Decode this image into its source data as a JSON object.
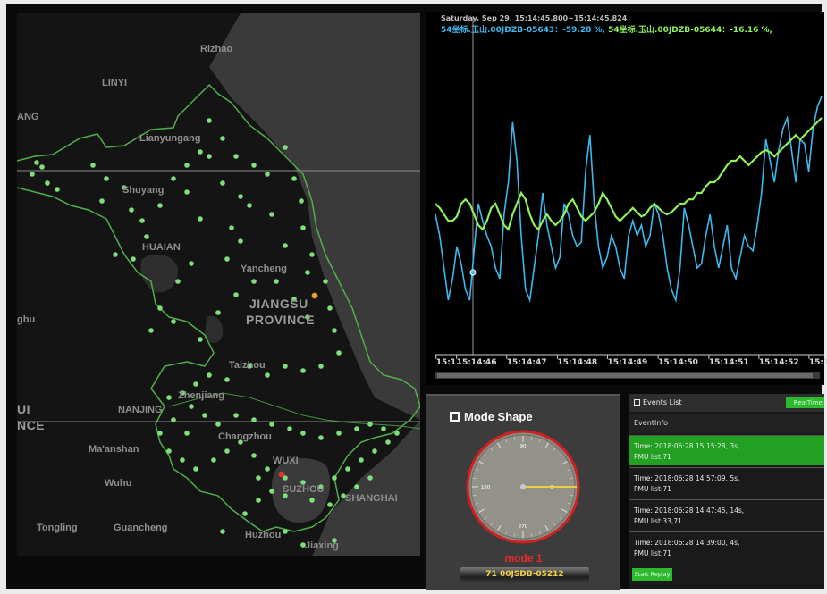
{
  "map": {
    "cities": [
      {
        "id": "rizhao",
        "label": "Rizhao",
        "big": false
      },
      {
        "id": "linyi",
        "label": "LINYI",
        "big": false
      },
      {
        "id": "lianyungang",
        "label": "Lianyungang",
        "big": false
      },
      {
        "id": "shuyang",
        "label": "Shuyang",
        "big": false
      },
      {
        "id": "huaian",
        "label": "HUAIAN",
        "big": false
      },
      {
        "id": "yancheng",
        "label": "Yancheng",
        "big": false
      },
      {
        "id": "jiangsu",
        "label": "JIANGSU",
        "big": true
      },
      {
        "id": "province",
        "label": "PROVINCE",
        "big": true
      },
      {
        "id": "taizhou",
        "label": "Taizhou",
        "big": false
      },
      {
        "id": "zhenjiang",
        "label": "Zhenjiang",
        "big": false
      },
      {
        "id": "nanjing",
        "label": "NANJING",
        "big": false
      },
      {
        "id": "changzhou",
        "label": "Changzhou",
        "big": false
      },
      {
        "id": "maanshan",
        "label": "Ma'anshan",
        "big": false
      },
      {
        "id": "wuxi",
        "label": "WUXI",
        "big": false
      },
      {
        "id": "wuhu",
        "label": "Wuhu",
        "big": false
      },
      {
        "id": "suzhou",
        "label": "SUZHOU",
        "big": false
      },
      {
        "id": "shanghai",
        "label": "SHANGHAI",
        "big": false
      },
      {
        "id": "tongling",
        "label": "Tongling",
        "big": false
      },
      {
        "id": "guancheng",
        "label": "Guancheng",
        "big": false
      },
      {
        "id": "huzhou",
        "label": "Huzhou",
        "big": false
      },
      {
        "id": "jiaxing",
        "label": "Jiaxing",
        "big": false
      },
      {
        "id": "ang",
        "label": "ANG",
        "big": false
      },
      {
        "id": "gbu",
        "label": "gbu",
        "big": false
      },
      {
        "id": "ui",
        "label": "UI",
        "big": false
      },
      {
        "id": "nce",
        "label": "NCE",
        "big": false
      }
    ],
    "colors": {
      "pmu_dot": "#7ee07a",
      "selected_dot": "#e83030",
      "highlight_dot": "#f0a030",
      "boundary": "#4fb04a",
      "land": "#141414",
      "sea": "#3a3a3a"
    }
  },
  "chart": {
    "header_line1": "Saturday, Sep 29, 15:14:45.800~15:14:45.824",
    "legend_a": "54坐标.玉山.00JDZB-05643：-59.28 %,",
    "legend_b": "54坐标.玉山.00JDZB-05644：-16.16 %,",
    "x_ticks": [
      "15:1...",
      "15:14:46",
      "15:14:47",
      "15:14:48",
      "15:14:49",
      "15:14:50",
      "15:14:51",
      "15:14:52",
      "15:1"
    ],
    "colors": {
      "series_a": "#3db8ef",
      "series_b": "#8ff05c"
    }
  },
  "chart_data": {
    "type": "line",
    "x_ticks": [
      "15:1...",
      "15:14:46",
      "15:14:47",
      "15:14:48",
      "15:14:49",
      "15:14:50",
      "15:14:51",
      "15:14:52",
      "15:1"
    ],
    "series": [
      {
        "name": "54坐标.玉山.00JDZB-05643",
        "color": "#3db8ef",
        "values": [
          0.45,
          0.35,
          0.2,
          0.05,
          0.15,
          0.3,
          0.22,
          0.1,
          0.05,
          0.28,
          0.5,
          0.42,
          0.35,
          0.3,
          0.2,
          0.15,
          0.45,
          0.6,
          0.88,
          0.7,
          0.35,
          0.1,
          0.05,
          0.2,
          0.35,
          0.55,
          0.4,
          0.3,
          0.2,
          0.25,
          0.5,
          0.45,
          0.35,
          0.3,
          0.32,
          0.65,
          0.82,
          0.5,
          0.3,
          0.2,
          0.25,
          0.35,
          0.3,
          0.2,
          0.15,
          0.35,
          0.42,
          0.35,
          0.4,
          0.3,
          0.35,
          0.5,
          0.45,
          0.35,
          0.2,
          0.1,
          0.05,
          0.2,
          0.48,
          0.4,
          0.3,
          0.2,
          0.22,
          0.35,
          0.45,
          0.3,
          0.2,
          0.3,
          0.4,
          0.2,
          0.15,
          0.25,
          0.35,
          0.3,
          0.28,
          0.4,
          0.55,
          0.8,
          0.7,
          0.6,
          0.75,
          0.85,
          0.9,
          0.75,
          0.6,
          0.8,
          0.78,
          0.65,
          0.85,
          0.95,
          1.0
        ]
      },
      {
        "name": "54坐标.玉山.00JDZB-05644",
        "color": "#8ff05c",
        "values": [
          0.5,
          0.48,
          0.45,
          0.42,
          0.42,
          0.44,
          0.5,
          0.52,
          0.5,
          0.45,
          0.4,
          0.38,
          0.42,
          0.48,
          0.5,
          0.45,
          0.4,
          0.38,
          0.45,
          0.5,
          0.55,
          0.52,
          0.45,
          0.4,
          0.38,
          0.42,
          0.45,
          0.42,
          0.4,
          0.42,
          0.45,
          0.5,
          0.52,
          0.48,
          0.44,
          0.42,
          0.44,
          0.46,
          0.5,
          0.55,
          0.52,
          0.48,
          0.44,
          0.42,
          0.44,
          0.46,
          0.48,
          0.46,
          0.44,
          0.45,
          0.48,
          0.5,
          0.48,
          0.46,
          0.45,
          0.46,
          0.48,
          0.5,
          0.5,
          0.52,
          0.52,
          0.55,
          0.55,
          0.58,
          0.6,
          0.6,
          0.62,
          0.65,
          0.68,
          0.7,
          0.7,
          0.72,
          0.7,
          0.68,
          0.7,
          0.72,
          0.74,
          0.75,
          0.74,
          0.72,
          0.74,
          0.76,
          0.78,
          0.8,
          0.82,
          0.8,
          0.82,
          0.84,
          0.86,
          0.88,
          0.9
        ]
      }
    ]
  },
  "mode_shape": {
    "title": "Mode Shape",
    "dial_labels": [
      "90",
      "180",
      "270",
      "0"
    ],
    "mode_label": "mode 1",
    "pmu_label": "71 00JSDB-05212",
    "needle_angle_deg": 0
  },
  "events": {
    "title": "Events List",
    "realtime_label": "RealTime",
    "column_header": "EventInfo",
    "rows": [
      {
        "line1": "Time: 2018:06:28 15:15:28, 3s,",
        "line2": "PMU list:71",
        "selected": true
      },
      {
        "line1": "Time: 2018:06:28 14:57:09, 5s,",
        "line2": "PMU list:71",
        "selected": false
      },
      {
        "line1": "Time: 2018:06:28 14:47:45, 14s,",
        "line2": "PMU list:33,71",
        "selected": false
      },
      {
        "line1": "Time: 2018:06:28 14:39:00, 4s,",
        "line2": "PMU list:71",
        "selected": false
      }
    ],
    "replay_label": "Start Replay"
  }
}
